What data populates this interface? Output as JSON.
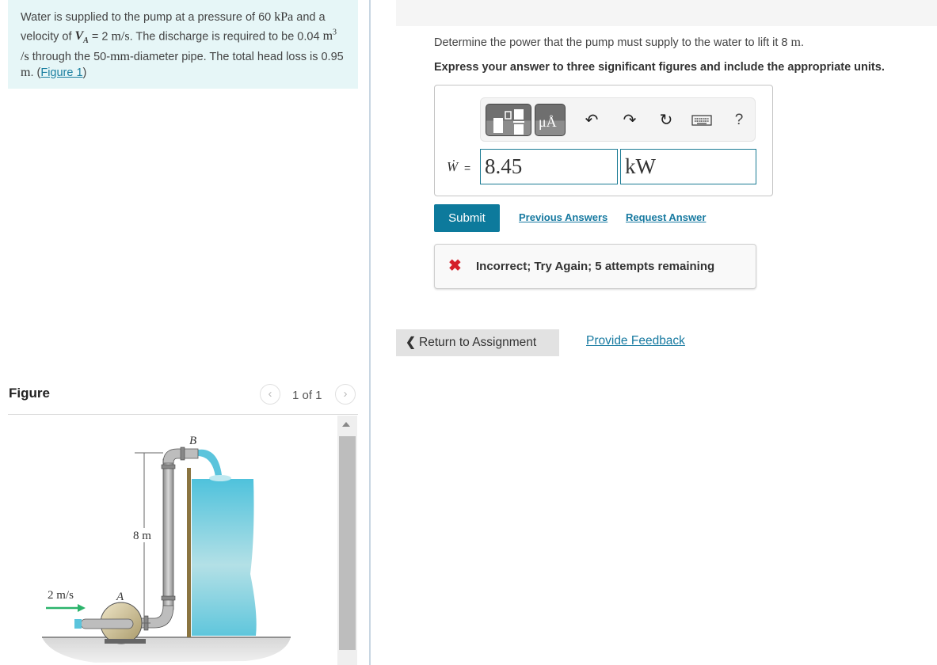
{
  "problem": {
    "text_1": "Water is supplied to the pump at a pressure of 60 ",
    "unit_kpa": "kPa",
    "text_2": " and a velocity of ",
    "var_va": "V",
    "var_va_sub": "A",
    "text_3": " = 2 ",
    "unit_ms": "m/s",
    "text_4": ". The discharge is required to be 0.04 ",
    "unit_m3": "m",
    "unit_m3_sup": "3",
    "unit_s": " /s",
    "text_5": " through the 50-",
    "unit_mm": "mm",
    "text_6": "-diameter pipe. The total head loss is 0.95 ",
    "unit_m": "m",
    "text_7": ". (",
    "figure_link": "Figure 1",
    "text_8": ")"
  },
  "figure": {
    "title": "Figure",
    "page_indicator": "1 of 1",
    "prev_icon": "chevron-left-icon",
    "next_icon": "chevron-right-icon",
    "labels": {
      "point_b": "B",
      "point_a": "A",
      "height": "8 m",
      "velocity": "2 m/s"
    },
    "colors": {
      "water": "#5bc4dc",
      "arrow": "#2bb36b",
      "pipe": "#a8a8a8"
    }
  },
  "question": {
    "text": "Determine the power that the pump must supply to the water to lift it 8 ",
    "unit": "m",
    "end": ".",
    "instruction": "Express your answer to three significant figures and include the appropriate units."
  },
  "answer": {
    "toolbar": {
      "templates_icon": "templates-icon",
      "units_icon": "units-icon",
      "units_label": "μÅ",
      "undo_icon": "undo-icon",
      "redo_icon": "redo-icon",
      "reset_icon": "reset-icon",
      "keyboard_icon": "keyboard-icon",
      "help_label": "?"
    },
    "variable": "Ẇ",
    "equals": "=",
    "value": "8.45",
    "units": "kW"
  },
  "actions": {
    "submit": "Submit",
    "previous_answers": "Previous Answers",
    "request_answer": "Request Answer"
  },
  "feedback": {
    "icon": "✖",
    "message": "Incorrect; Try Again; 5 attempts remaining",
    "color": "#d41f2a"
  },
  "footer": {
    "return_label": "Return to Assignment",
    "feedback_label": "Provide Feedback"
  }
}
